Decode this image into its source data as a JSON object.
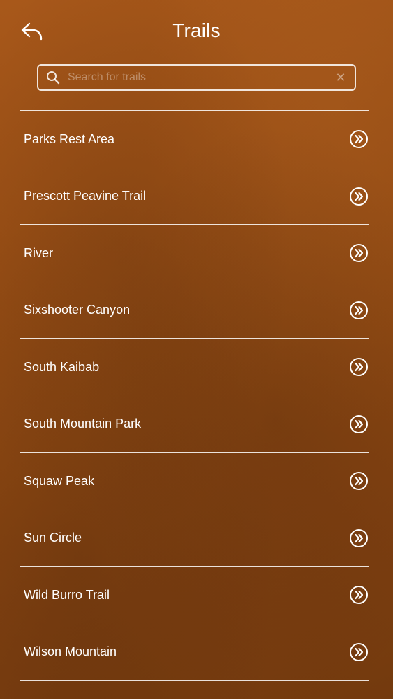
{
  "header": {
    "title": "Trails",
    "back_icon": "back-arrow-icon"
  },
  "search": {
    "placeholder": "Search for trails",
    "value": "",
    "icon": "search-icon",
    "clear_icon": "clear-icon",
    "clear_glyph": "✕"
  },
  "trails": {
    "items": [
      {
        "label": "Parks Rest Area"
      },
      {
        "label": "Prescott Peavine Trail"
      },
      {
        "label": "River"
      },
      {
        "label": "Sixshooter Canyon"
      },
      {
        "label": "South Kaibab"
      },
      {
        "label": "South Mountain Park"
      },
      {
        "label": "Squaw Peak"
      },
      {
        "label": "Sun Circle"
      },
      {
        "label": "Wild Burro Trail"
      },
      {
        "label": "Wilson Mountain"
      }
    ]
  },
  "colors": {
    "background_top": "#a8581a",
    "background_bottom": "#733a0e",
    "foreground": "#ffffff"
  }
}
